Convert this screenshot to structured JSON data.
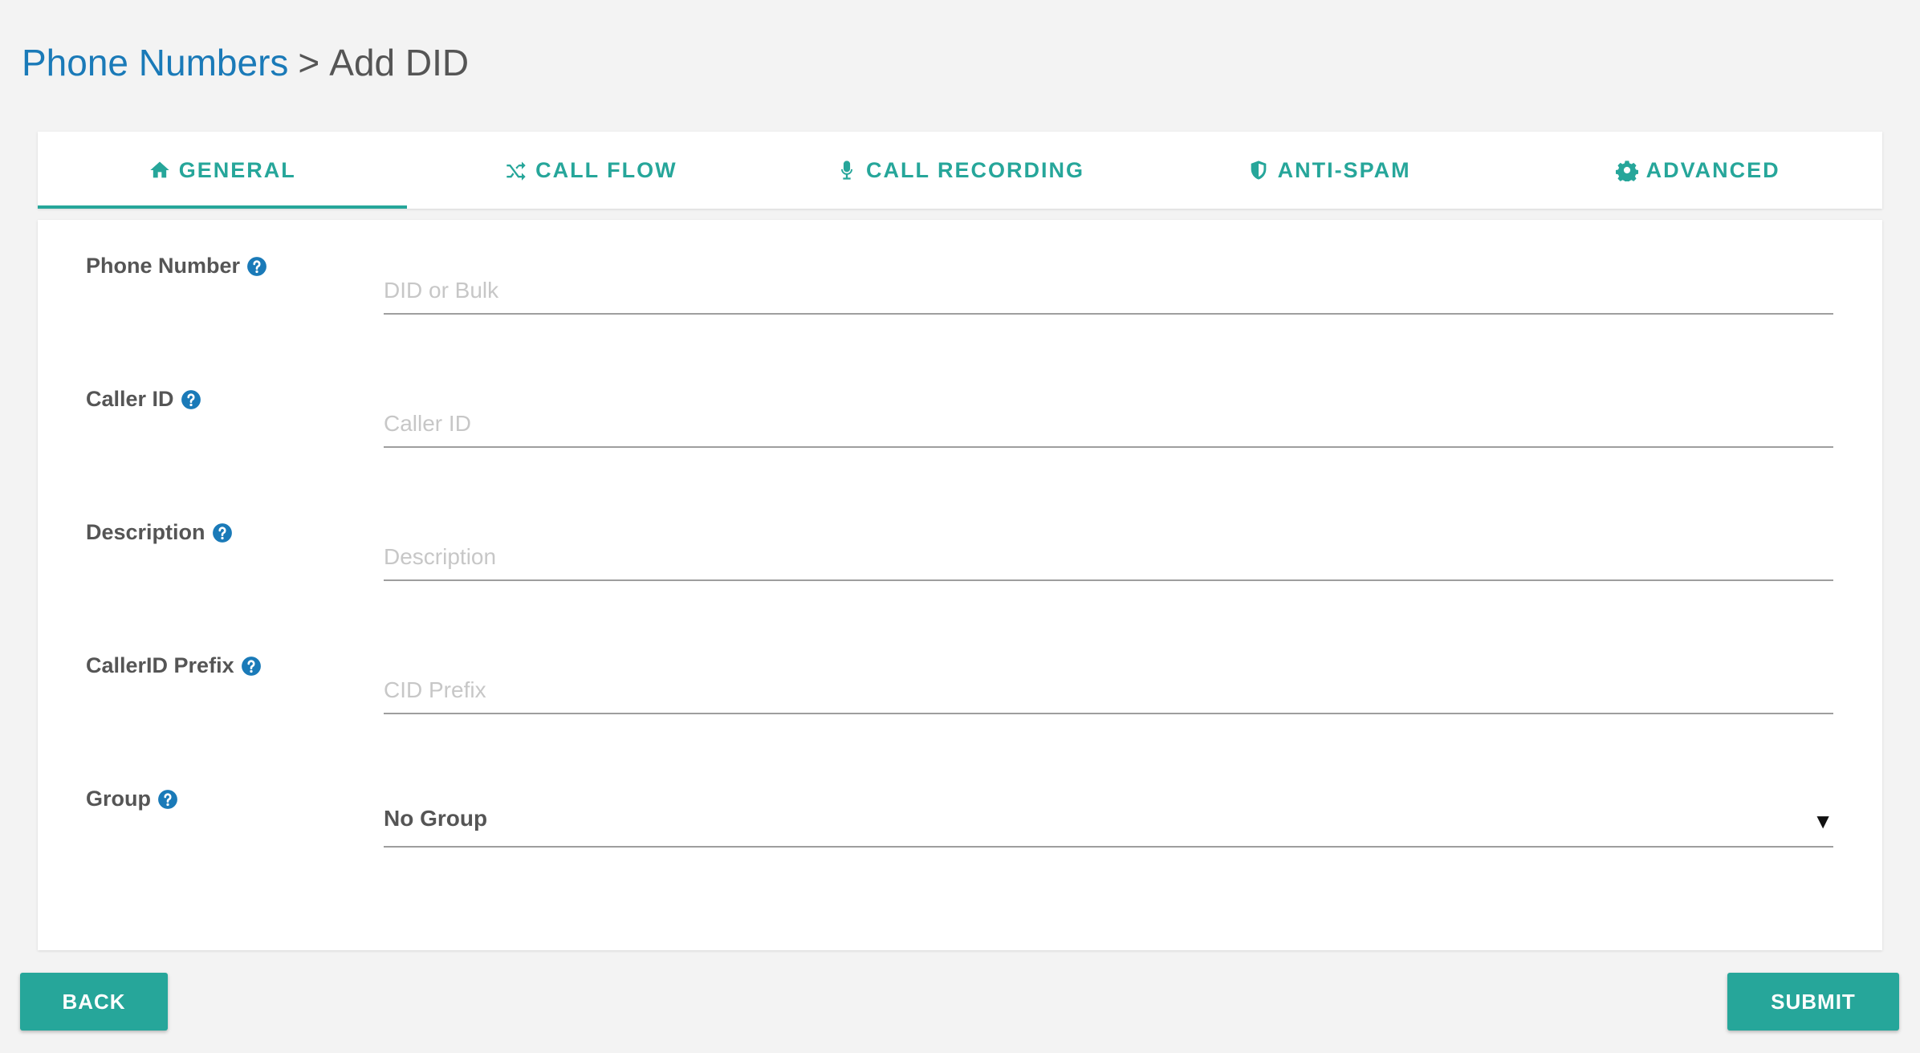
{
  "breadcrumb": {
    "parent": "Phone Numbers",
    "separator": ">",
    "current": "Add DID"
  },
  "tabs": [
    {
      "label": "GENERAL",
      "icon": "home-icon",
      "active": true
    },
    {
      "label": "CALL FLOW",
      "icon": "shuffle-icon",
      "active": false
    },
    {
      "label": "CALL RECORDING",
      "icon": "microphone-icon",
      "active": false
    },
    {
      "label": "ANTI-SPAM",
      "icon": "shield-icon",
      "active": false
    },
    {
      "label": "ADVANCED",
      "icon": "gear-icon",
      "active": false
    }
  ],
  "form": {
    "phone_number": {
      "label": "Phone Number",
      "placeholder": "DID or Bulk",
      "value": ""
    },
    "caller_id": {
      "label": "Caller ID",
      "placeholder": "Caller ID",
      "value": ""
    },
    "description": {
      "label": "Description",
      "placeholder": "Description",
      "value": ""
    },
    "callerid_prefix": {
      "label": "CallerID Prefix",
      "placeholder": "CID Prefix",
      "value": ""
    },
    "group": {
      "label": "Group",
      "selected": "No Group",
      "caret": "▼"
    }
  },
  "buttons": {
    "back": "BACK",
    "submit": "SUBMIT"
  },
  "colors": {
    "accent": "#26a69a",
    "link": "#1a7ab8",
    "background": "#f3f3f3"
  }
}
